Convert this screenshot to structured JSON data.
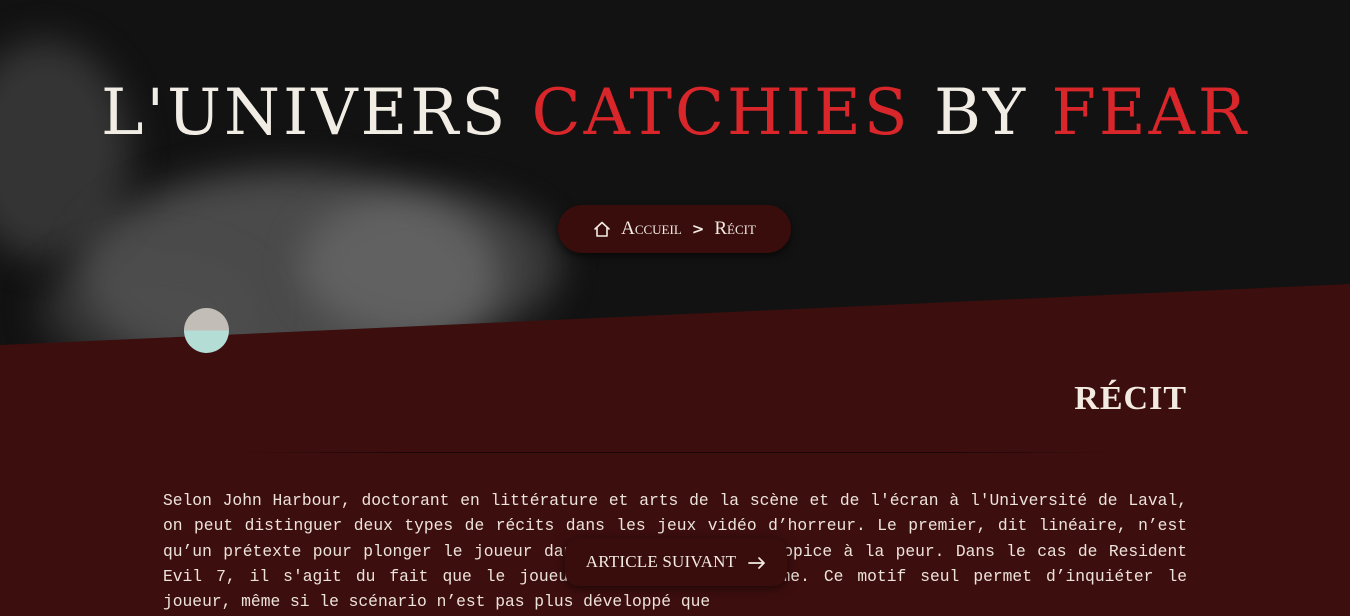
{
  "header": {
    "title_part1": "L'UNIVERS",
    "title_part2": "CATCHIES",
    "title_part3": "BY",
    "title_part4": "FEAR",
    "title_white_color": "#f1ede5",
    "title_red_color": "#d8262a"
  },
  "breadcrumb": {
    "icon": "home-icon",
    "home_label": "Accueil",
    "separator": ">",
    "current_label": "Récit"
  },
  "section": {
    "title": "RÉCIT"
  },
  "article": {
    "text": "Selon John Harbour, doctorant en littérature et arts de la scène et de l'écran à l'Université de Laval, on peut distinguer deux types de récits dans les jeux vidéo d’horreur. Le premier, dit linéaire, n’est qu’un prétexte pour plonger le joueur dans un environnement propice à la peur. Dans le cas de Resident Evil 7, il s'agit du fait que le joueur doit sauver sa femme. Ce motif seul permet d’inquiéter le joueur, même si le scénario n’est pas plus développé que"
  },
  "next_article": {
    "label": "ARTICLE SUIVANT",
    "icon": "arrow-right-icon"
  },
  "colors": {
    "hero_background": "#121212",
    "content_background": "#3d0e0e",
    "pill_background": "#3a0d0d",
    "text": "#ece3d9"
  }
}
